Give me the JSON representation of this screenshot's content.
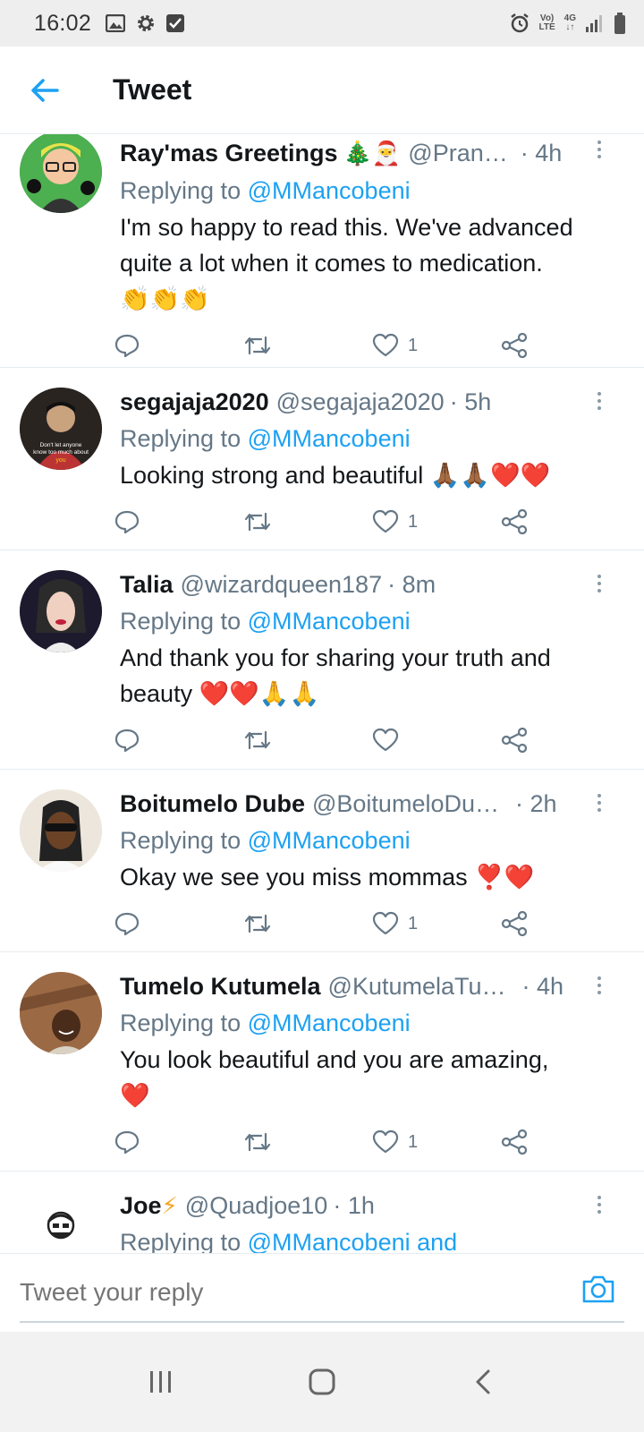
{
  "status_bar": {
    "time": "16:02",
    "network_top": "Vo)",
    "network_bottom": "LTE",
    "cell_type": "4G",
    "icons": [
      "gallery-icon",
      "settings-icon",
      "checkbox-icon",
      "alarm-icon",
      "signal-icon",
      "battery-icon"
    ]
  },
  "header": {
    "title": "Tweet",
    "back_icon": "arrow-left-icon"
  },
  "tweets": [
    {
      "name": "Ray'mas Greetings",
      "emoji": "🎄🎅",
      "handle": "@Pran…",
      "time": "· 4h",
      "replying_prefix": "Replying to",
      "replying_to": "@MMancobeni",
      "text": "I'm so happy to read this. We've advanced quite a lot when it comes to medication.",
      "text_emoji": "👏👏👏",
      "likes": "1"
    },
    {
      "name": "segajaja2020",
      "emoji": "",
      "handle": "@segajaja2020",
      "time": "· 5h",
      "replying_prefix": "Replying to",
      "replying_to": "@MMancobeni",
      "text": "Looking strong and beautiful",
      "text_emoji": "🙏🏾🙏🏾❤️❤️",
      "likes": "1",
      "avatar_caption": "Don't let anyone know too much about you"
    },
    {
      "name": "Talia",
      "emoji": "",
      "handle": "@wizardqueen187",
      "time": "· 8m",
      "replying_prefix": "Replying to",
      "replying_to": "@MMancobeni",
      "text": "And thank you for sharing your truth and beauty",
      "text_emoji": "❤️❤️🙏🙏",
      "likes": ""
    },
    {
      "name": "Boitumelo Dube",
      "emoji": "",
      "handle": "@BoitumeloDu…",
      "time": "· 2h",
      "replying_prefix": "Replying to",
      "replying_to": "@MMancobeni",
      "text": "Okay we see you miss mommas",
      "text_emoji": "❣️❤️",
      "likes": "1"
    },
    {
      "name": "Tumelo Kutumela",
      "emoji": "",
      "handle": "@KutumelaTu…",
      "time": "· 4h",
      "replying_prefix": "Replying to",
      "replying_to": "@MMancobeni",
      "text": "You look beautiful and you are amazing,",
      "text_emoji": "❤️",
      "likes": "1"
    },
    {
      "name": "Joe",
      "emoji": "⚡",
      "handle": "@Quadjoe10",
      "time": "· 1h",
      "replying_prefix": "Replying to",
      "replying_to": "@MMancobeni and",
      "text": "",
      "text_emoji": "",
      "likes": ""
    }
  ],
  "reply_bar": {
    "placeholder": "Tweet your reply",
    "camera_icon": "camera-icon"
  },
  "nav_bar": {
    "icons": [
      "recents-icon",
      "home-icon",
      "back-icon"
    ]
  },
  "colors": {
    "accent": "#1da1f2",
    "secondary_text": "#657786",
    "primary_text": "#14171a",
    "divider": "#e6ecf0",
    "status_bg": "#eeeeee"
  }
}
